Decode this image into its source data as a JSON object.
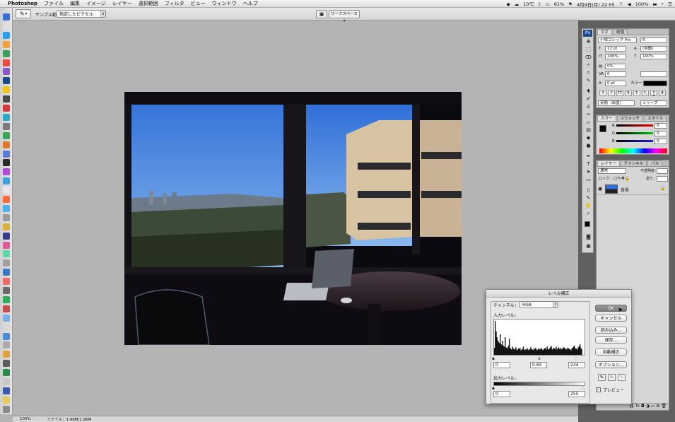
{
  "menubar": {
    "app_name": "Photoshop",
    "items": [
      "ファイル",
      "編集",
      "イメージ",
      "レイヤー",
      "選択範囲",
      "フィルタ",
      "ビュー",
      "ウィンドウ",
      "ヘルプ"
    ],
    "weather": "10℃",
    "battery": "61%",
    "date_time": "4月9日(月) 22:55",
    "battery2": "100%"
  },
  "options": {
    "sample_label": "サンプル範囲：",
    "sample_value": "指定したピクセル",
    "workspace": "ワークスペース ▾"
  },
  "status": {
    "zoom": "100%",
    "doc": "ファイル：1.96M/1.96M"
  },
  "tools_panel": {
    "ps_logo": "Ps"
  },
  "char_panel": {
    "tabs": [
      "文字",
      "段落"
    ],
    "font": "小塚ゴシック Pro",
    "style": "R",
    "size": "12 pt",
    "leading": "(自動)",
    "scale_v": "100%",
    "scale_h": "100%",
    "tracking": "0%",
    "kerning": "0",
    "baseline": "0 pt",
    "color_label": "カラー：",
    "lang": "英語（米国）",
    "aa": "シャープ",
    "style_buttons": [
      "T",
      "T",
      "TT",
      "Tr",
      "T'",
      "T,",
      "T",
      "T"
    ]
  },
  "color_panel": {
    "tabs": [
      "カラー",
      "スウォッチ",
      "スタイル"
    ],
    "channels": [
      {
        "name": "R",
        "value": "0",
        "color": "#d02020"
      },
      {
        "name": "G",
        "value": "0",
        "color": "#20b020"
      },
      {
        "name": "B",
        "value": "0",
        "color": "#2040d0"
      }
    ]
  },
  "layers_panel": {
    "tabs": [
      "レイヤー",
      "チャンネル",
      "パス"
    ],
    "blend": "通常",
    "opacity_label": "不透明度：",
    "lock_label": "ロック：",
    "fill_label": "塗り：",
    "layer_name": "背景"
  },
  "levels_dialog": {
    "title": "レベル補正",
    "channel_label": "チャンネル：",
    "channel": "RGB",
    "input_label": "入力レベル：",
    "input_black": "0",
    "input_gamma": "0.84",
    "input_white": "234",
    "output_label": "出力レベル：",
    "output_black": "0",
    "output_white": "255",
    "buttons": {
      "ok": "OK",
      "cancel": "キャンセル",
      "load": "読み込み...",
      "save": "保存...",
      "auto": "自動補正",
      "options": "オプション..."
    },
    "preview_label": "プレビュー",
    "histogram": [
      12,
      58,
      40,
      30,
      25,
      22,
      20,
      35,
      18,
      17,
      24,
      15,
      14,
      30,
      12,
      13,
      11,
      16,
      28,
      12,
      10,
      9,
      14,
      11,
      9,
      10,
      13,
      8,
      9,
      11,
      10,
      12,
      8,
      9,
      10,
      14,
      9,
      8,
      10,
      9,
      11,
      8,
      10,
      9,
      13,
      10,
      9,
      8,
      11,
      10,
      12,
      9,
      8,
      10,
      11,
      9,
      10,
      12,
      9,
      8,
      10,
      11,
      12,
      9,
      14,
      10,
      9,
      11,
      13,
      15,
      10,
      9,
      12,
      11,
      10,
      14,
      9,
      11,
      13,
      10,
      12,
      9,
      11,
      10,
      13,
      12,
      11,
      9,
      10,
      12,
      11,
      10,
      9,
      8,
      11,
      12,
      14,
      16,
      12,
      10,
      11,
      9,
      13,
      15,
      18,
      12,
      10,
      0,
      0,
      0
    ]
  }
}
